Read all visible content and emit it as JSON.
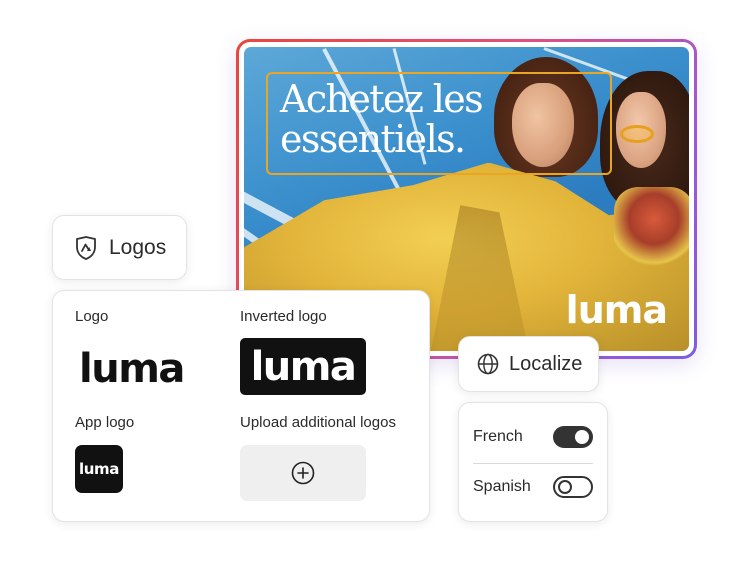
{
  "hero": {
    "headline_line1": "Achetez les",
    "headline_line2": "essentiels.",
    "brand": "luma",
    "colors": {
      "accent_box": "#e8a624",
      "frame_gradient_start": "#e8473b",
      "frame_gradient_end": "#7a5ce0"
    }
  },
  "logos_chip": {
    "icon": "shield-logo-icon",
    "label": "Logos"
  },
  "logos_panel": {
    "logo_label": "Logo",
    "logo_wordmark": "luma",
    "inverted_label": "Inverted logo",
    "inverted_wordmark": "luma",
    "app_logo_label": "App logo",
    "app_logo_wordmark": "luma",
    "upload_label": "Upload additional logos",
    "upload_icon": "plus-circle-icon"
  },
  "localize_chip": {
    "icon": "globe-icon",
    "label": "Localize"
  },
  "languages": [
    {
      "label": "French",
      "enabled": true
    },
    {
      "label": "Spanish",
      "enabled": false
    }
  ]
}
